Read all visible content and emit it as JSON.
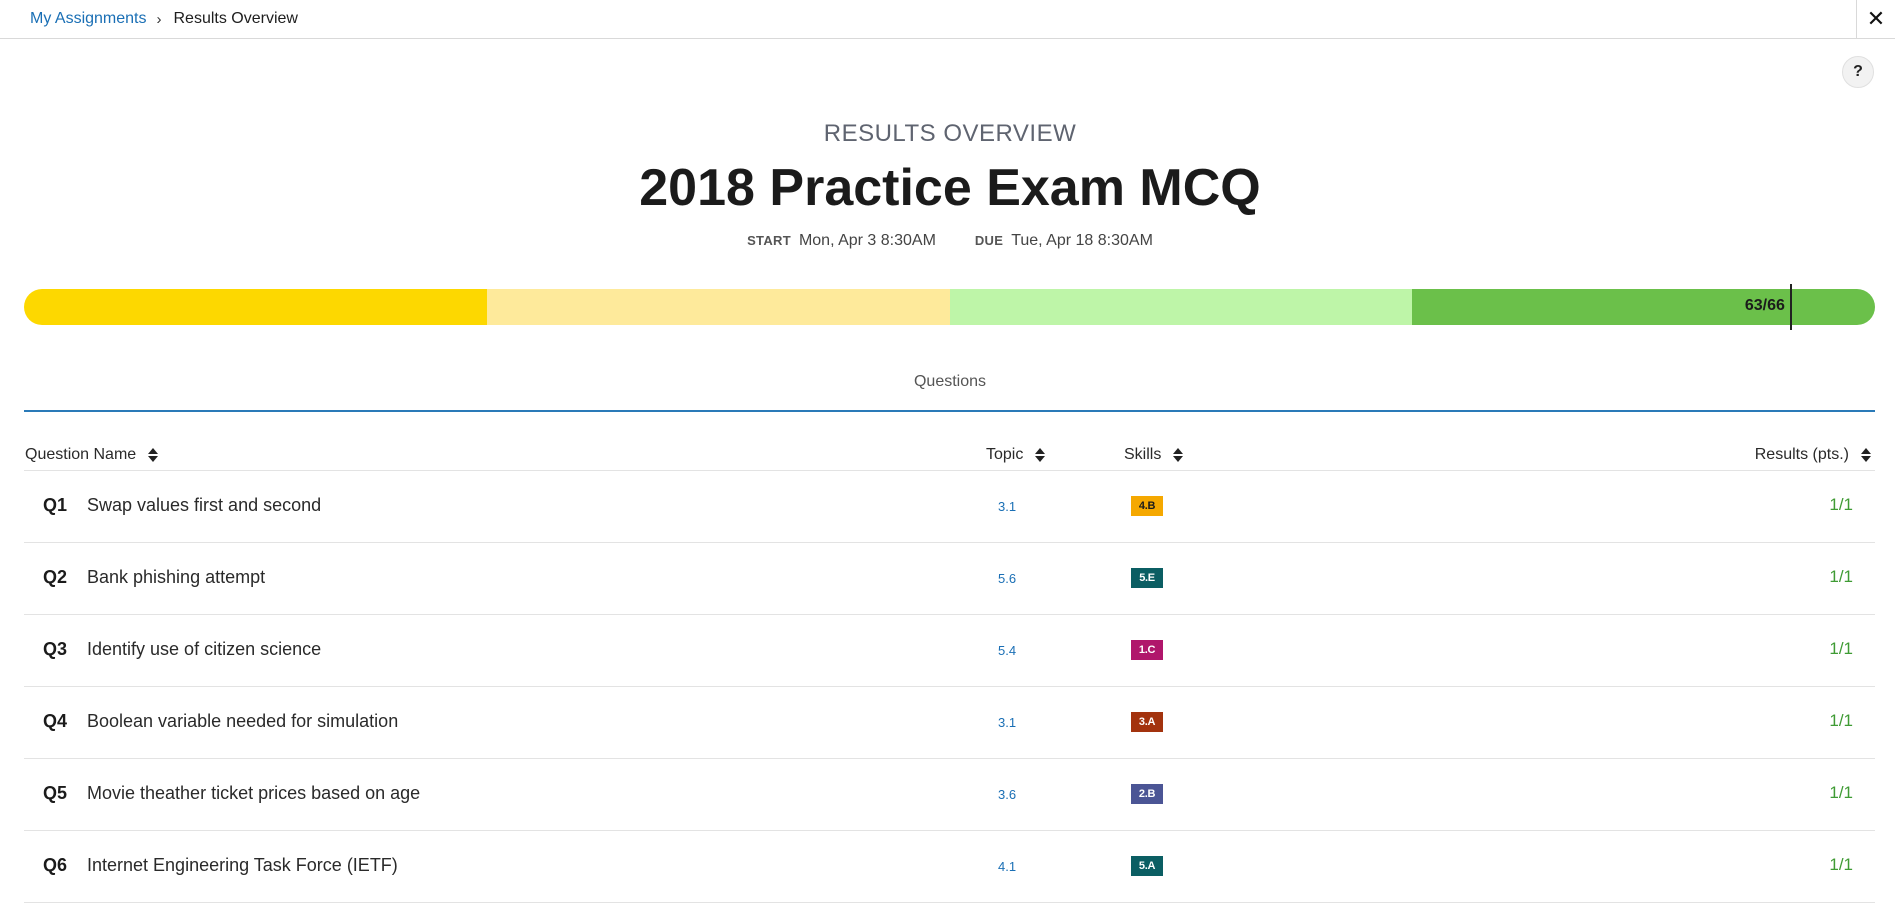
{
  "breadcrumb": {
    "parent": "My Assignments",
    "separator": "›",
    "current": "Results Overview"
  },
  "close_icon": "✕",
  "help_label": "?",
  "header": {
    "overview_label": "RESULTS OVERVIEW",
    "title": "2018 Practice Exam MCQ",
    "start_label": "START",
    "start_value": "Mon, Apr 3 8:30AM",
    "due_label": "DUE",
    "due_value": "Tue, Apr 18 8:30AM"
  },
  "progress": {
    "score_label": "63/66",
    "score": 63,
    "total": 66,
    "segment_colors": [
      "#fdd800",
      "#feea9b",
      "#bef5a8",
      "#6bc04a"
    ]
  },
  "tabs": {
    "questions": "Questions"
  },
  "table": {
    "columns": {
      "name": "Question Name",
      "topic": "Topic",
      "skills": "Skills",
      "results": "Results (pts.)"
    },
    "rows": [
      {
        "num": "Q1",
        "name": "Swap values first and second",
        "topic": "3.1",
        "skill": "4.B",
        "skill_color": "#f5a800",
        "skill_text_color": "#1b1b1b",
        "result": "1/1"
      },
      {
        "num": "Q2",
        "name": "Bank phishing attempt",
        "topic": "5.6",
        "skill": "5.E",
        "skill_color": "#0b5e63",
        "skill_text_color": "#ffffff",
        "result": "1/1"
      },
      {
        "num": "Q3",
        "name": "Identify use of citizen science",
        "topic": "5.4",
        "skill": "1.C",
        "skill_color": "#b0166b",
        "skill_text_color": "#ffffff",
        "result": "1/1"
      },
      {
        "num": "Q4",
        "name": "Boolean variable needed for simulation",
        "topic": "3.1",
        "skill": "3.A",
        "skill_color": "#a3330e",
        "skill_text_color": "#ffffff",
        "result": "1/1"
      },
      {
        "num": "Q5",
        "name": "Movie theather ticket prices based on age",
        "topic": "3.6",
        "skill": "2.B",
        "skill_color": "#4b5595",
        "skill_text_color": "#ffffff",
        "result": "1/1"
      },
      {
        "num": "Q6",
        "name": "Internet Engineering Task Force (IETF)",
        "topic": "4.1",
        "skill": "5.A",
        "skill_color": "#0b5e63",
        "skill_text_color": "#ffffff",
        "result": "1/1"
      }
    ]
  }
}
